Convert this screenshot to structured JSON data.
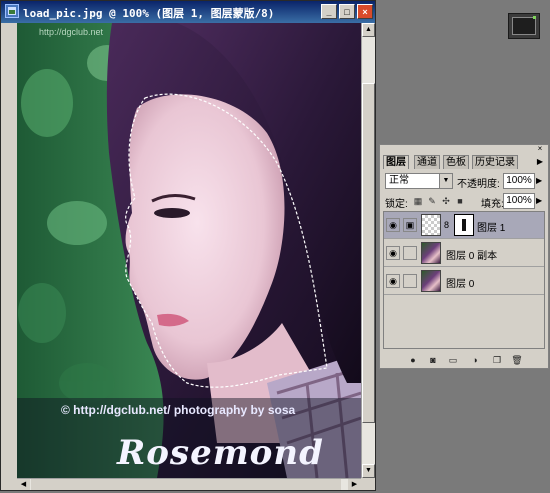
{
  "document": {
    "title": "load_pic.jpg @ 100% (图层 1, 图层蒙版/8)",
    "watermark_site": "© http://dgclub.net/  photography by sosa",
    "watermark_corner": "http://dgclub.net",
    "signature": "Rosemond"
  },
  "window_buttons": {
    "minimize": "_",
    "maximize": "□",
    "close": "×"
  },
  "layers_panel": {
    "tabs": [
      {
        "label": "图层",
        "active": true
      },
      {
        "label": "通道",
        "active": false
      },
      {
        "label": "色板",
        "active": false
      },
      {
        "label": "历史记录",
        "active": false
      }
    ],
    "blend_mode": "正常",
    "opacity_label": "不透明度:",
    "opacity_value": "100%",
    "lock_label": "锁定:",
    "fill_label": "填充:",
    "fill_value": "100%",
    "layers": [
      {
        "name": "图层 1",
        "selected": true,
        "has_mask": true
      },
      {
        "name": "图层 0 副本",
        "selected": false,
        "has_mask": false
      },
      {
        "name": "图层 0",
        "selected": false,
        "has_mask": false
      }
    ]
  }
}
